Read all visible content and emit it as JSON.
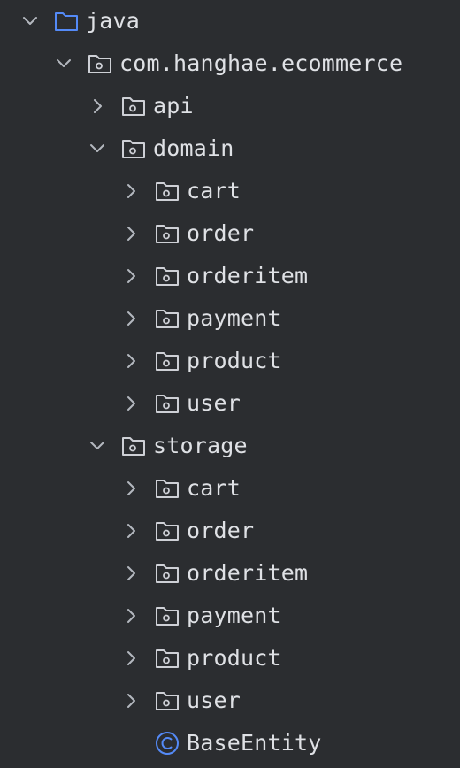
{
  "tree": {
    "rows": [
      {
        "label": "java",
        "depth": 0,
        "icon": "folder-icon",
        "expanded": true
      },
      {
        "label": "com.hanghae.ecommerce",
        "depth": 1,
        "icon": "package-icon",
        "expanded": true
      },
      {
        "label": "api",
        "depth": 2,
        "icon": "package-icon",
        "expanded": false
      },
      {
        "label": "domain",
        "depth": 2,
        "icon": "package-icon",
        "expanded": true
      },
      {
        "label": "cart",
        "depth": 3,
        "icon": "package-icon",
        "expanded": false
      },
      {
        "label": "order",
        "depth": 3,
        "icon": "package-icon",
        "expanded": false
      },
      {
        "label": "orderitem",
        "depth": 3,
        "icon": "package-icon",
        "expanded": false
      },
      {
        "label": "payment",
        "depth": 3,
        "icon": "package-icon",
        "expanded": false
      },
      {
        "label": "product",
        "depth": 3,
        "icon": "package-icon",
        "expanded": false
      },
      {
        "label": "user",
        "depth": 3,
        "icon": "package-icon",
        "expanded": false
      },
      {
        "label": "storage",
        "depth": 2,
        "icon": "package-icon",
        "expanded": true
      },
      {
        "label": "cart",
        "depth": 3,
        "icon": "package-icon",
        "expanded": false
      },
      {
        "label": "order",
        "depth": 3,
        "icon": "package-icon",
        "expanded": false
      },
      {
        "label": "orderitem",
        "depth": 3,
        "icon": "package-icon",
        "expanded": false
      },
      {
        "label": "payment",
        "depth": 3,
        "icon": "package-icon",
        "expanded": false
      },
      {
        "label": "product",
        "depth": 3,
        "icon": "package-icon",
        "expanded": false
      },
      {
        "label": "user",
        "depth": 3,
        "icon": "package-icon",
        "expanded": false
      },
      {
        "label": "BaseEntity",
        "depth": 3,
        "icon": "class-icon",
        "leaf": true
      }
    ]
  },
  "colors": {
    "background": "#2b2d30",
    "text": "#dfe1e5",
    "arrow": "#b4b8bf",
    "folder": "#548af7",
    "package": "#ced0d6",
    "class": "#548af7"
  }
}
